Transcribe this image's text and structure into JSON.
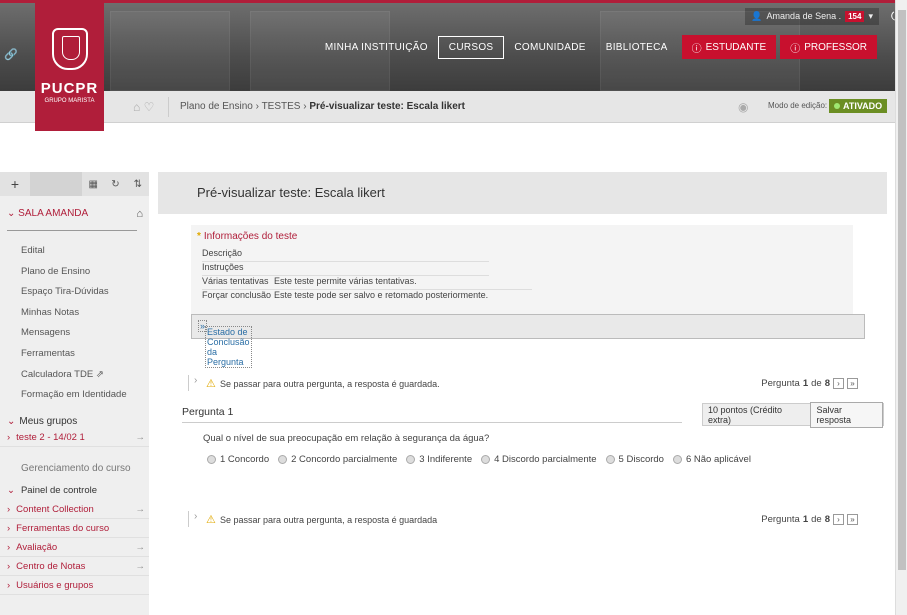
{
  "header": {
    "logo": {
      "name": "PUCPR",
      "sub": "GRUPO MARISTA"
    },
    "user": {
      "name": "Amanda de Sena .",
      "count": "154"
    },
    "nav": [
      "MINHA INSTITUIÇÃO",
      "CURSOS",
      "COMUNIDADE",
      "BIBLIOTECA"
    ],
    "buttons": [
      "ESTUDANTE",
      "PROFESSOR"
    ]
  },
  "breadcrumb": {
    "path1": "Plano de Ensino",
    "path2": "TESTES",
    "current": "Pré-visualizar teste: Escala likert",
    "edit_mode_label": "Modo de edição:",
    "edit_mode_value": "ATIVADO"
  },
  "sidebar": {
    "course": "SALA AMANDA",
    "links": [
      "Edital",
      "Plano de Ensino",
      "Espaço Tira-Dúvidas",
      "Minhas Notas",
      "Mensagens",
      "Ferramentas",
      "Calculadora TDE",
      "Formação em Identidade"
    ],
    "groups_header": "Meus grupos",
    "group": "teste 2 - 14/02 1",
    "manage": "Gerenciamento do curso",
    "panel": "Painel de controle",
    "panel_items": [
      "Content Collection",
      "Ferramentas do curso",
      "Avaliação",
      "Centro de Notas",
      "Usuários e grupos"
    ]
  },
  "main": {
    "title": "Pré-visualizar teste: Escala likert",
    "info_title": "Informações do teste",
    "info_rows": [
      {
        "k": "Descrição",
        "v": ""
      },
      {
        "k": "Instruções",
        "v": ""
      },
      {
        "k": "Várias tentativas",
        "v": "Este teste permite várias tentativas."
      },
      {
        "k": "Forçar conclusão",
        "v": "Este teste pode ser salvo e retomado posteriormente."
      }
    ],
    "estado": "Estado de Conclusão da Pergunta",
    "warning": "Se passar para outra pergunta, a resposta é guardada.",
    "warning2": "Se passar para outra pergunta, a resposta é guardada",
    "page_label": "Pergunta",
    "page_num": "1",
    "page_of": "de",
    "page_total": "8",
    "question_title": "Pergunta 1",
    "points": "10 pontos (Crédito extra)",
    "save": "Salvar resposta",
    "question": "Qual o nível de sua preocupação em relação à segurança da água?",
    "options": [
      "1 Concordo",
      "2 Concordo parcialmente",
      "3 Indiferente",
      "4 Discordo parcialmente",
      "5 Discordo",
      "6 Não aplicável"
    ]
  }
}
